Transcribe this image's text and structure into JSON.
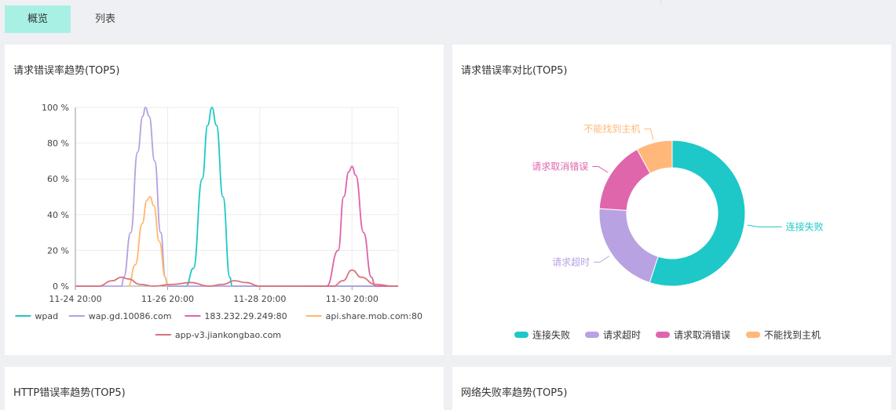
{
  "tabs": [
    {
      "label": "概览",
      "active": true
    },
    {
      "label": "列表",
      "active": false
    }
  ],
  "cards": {
    "trend": {
      "title": "请求错误率趋势(TOP5)"
    },
    "compare": {
      "title": "请求错误率对比(TOP5)"
    },
    "http": {
      "title": "HTTP错误率趋势(TOP5)"
    },
    "network": {
      "title": "网络失败率趋势(TOP5)"
    }
  },
  "chart_data": [
    {
      "type": "line",
      "title": "请求错误率趋势(TOP5)",
      "y_ticks": [
        "0 %",
        "20 %",
        "40 %",
        "60 %",
        "80 %",
        "100 %"
      ],
      "x_ticks": [
        "11-24 20:00",
        "11-26 20:00",
        "11-28 20:00",
        "11-30 20:00"
      ],
      "ylim": [
        0,
        100
      ],
      "grid": true,
      "legend_position": "bottom",
      "series": [
        {
          "name": "wpad",
          "color": "#1ec8c8",
          "points": [
            [
              2.0,
              0
            ],
            [
              2.4,
              0
            ],
            [
              2.56,
              10
            ],
            [
              2.75,
              60
            ],
            [
              2.87,
              90
            ],
            [
              2.96,
              100
            ],
            [
              3.06,
              90
            ],
            [
              3.2,
              50
            ],
            [
              3.35,
              5
            ],
            [
              3.4,
              0
            ],
            [
              7.0,
              0
            ]
          ]
        },
        {
          "name": "wap.gd.10086.com",
          "color": "#b5a0e0",
          "points": [
            [
              0,
              0
            ],
            [
              1.0,
              0
            ],
            [
              1.05,
              5
            ],
            [
              1.2,
              30
            ],
            [
              1.35,
              75
            ],
            [
              1.46,
              95
            ],
            [
              1.52,
              100
            ],
            [
              1.6,
              95
            ],
            [
              1.72,
              70
            ],
            [
              1.85,
              30
            ],
            [
              1.95,
              5
            ],
            [
              2.0,
              0
            ],
            [
              7.0,
              0
            ]
          ]
        },
        {
          "name": "183.232.29.249:80",
          "color": "#e063aa",
          "points": [
            [
              5.0,
              0
            ],
            [
              5.45,
              0
            ],
            [
              5.7,
              20
            ],
            [
              5.82,
              50
            ],
            [
              5.93,
              64
            ],
            [
              6.0,
              67
            ],
            [
              6.08,
              62
            ],
            [
              6.25,
              30
            ],
            [
              6.42,
              5
            ],
            [
              6.5,
              0
            ],
            [
              7.0,
              0
            ]
          ]
        },
        {
          "name": "api.share.mob.com:80",
          "color": "#ffb870",
          "points": [
            [
              1.15,
              0
            ],
            [
              1.3,
              12
            ],
            [
              1.45,
              35
            ],
            [
              1.55,
              48
            ],
            [
              1.62,
              50
            ],
            [
              1.7,
              45
            ],
            [
              1.82,
              25
            ],
            [
              1.95,
              5
            ],
            [
              2.0,
              0
            ]
          ]
        },
        {
          "name": "app-v3.jiankongbao.com",
          "color": "#d9727a",
          "points": [
            [
              0,
              0
            ],
            [
              0.5,
              0
            ],
            [
              0.8,
              3
            ],
            [
              1.0,
              5
            ],
            [
              1.15,
              4
            ],
            [
              1.4,
              1
            ],
            [
              1.7,
              0
            ],
            [
              2.1,
              1
            ],
            [
              2.5,
              2
            ],
            [
              2.9,
              0
            ],
            [
              3.2,
              1
            ],
            [
              3.45,
              3
            ],
            [
              3.7,
              2
            ],
            [
              4.0,
              0
            ],
            [
              5.6,
              0
            ],
            [
              5.8,
              3
            ],
            [
              6.0,
              9
            ],
            [
              6.2,
              5
            ],
            [
              6.5,
              1
            ],
            [
              6.9,
              0
            ],
            [
              7.0,
              0
            ]
          ]
        }
      ]
    },
    {
      "type": "pie",
      "title": "请求错误率对比(TOP5)",
      "legend_position": "bottom",
      "slices": [
        {
          "name": "连接失败",
          "value": 55,
          "color": "#1ec8c8"
        },
        {
          "name": "请求超时",
          "value": 21,
          "color": "#b8a2e2"
        },
        {
          "name": "请求取消错误",
          "value": 16,
          "color": "#e066ac"
        },
        {
          "name": "不能找到主机",
          "value": 8,
          "color": "#ffb87a"
        }
      ]
    }
  ]
}
